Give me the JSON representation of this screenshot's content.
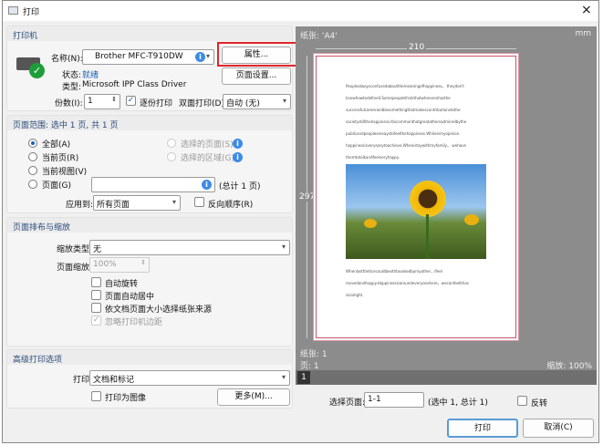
{
  "window": {
    "title": "打印",
    "close_icon": "×"
  },
  "printer": {
    "section_title": "打印机",
    "name_label": "名称(N):",
    "name_value": "Brother MFC-T910DW",
    "properties_button": "属性...",
    "page_setup_button": "页面设置...",
    "status_label": "状态:",
    "status_value": "就绪",
    "type_label": "类型:",
    "type_value": "Microsoft IPP Class Driver",
    "copies_label": "份数(I):",
    "copies_value": "1",
    "collate_label": "逐份打印",
    "collate_checked": true,
    "duplex_label": "双面打印(D)",
    "duplex_value": "自动 (无)"
  },
  "range": {
    "section_title": "页面范围: 选中 1 页, 共 1 页",
    "all": "全部(A)",
    "current_page": "当前页(R)",
    "current_view": "当前视图(V)",
    "pages": "页面(G)",
    "selected_pages": "选择的页面(S)",
    "selected_area": "选择的区域(G)",
    "pages_value": "",
    "total": "(总计 1 页)",
    "apply_label": "应用到:",
    "apply_value": "所有页面",
    "reverse_label": "反向顺序(R)"
  },
  "layout": {
    "section_title": "页面排布与缩放",
    "scale_type_label": "缩放类型:",
    "scale_type_value": "无",
    "page_scale_label": "页面缩放:",
    "page_scale_value": "100%",
    "auto_rotate": "自动旋转",
    "auto_center": "页面自动居中",
    "paper_source": "依文档页面大小选择纸张来源",
    "ignore_margins": "忽略打印机边距"
  },
  "advanced": {
    "section_title": "高级打印选项",
    "print_label": "打印",
    "print_value": "文档和标记",
    "print_as_image": "打印为图像",
    "more_button": "更多(M)..."
  },
  "preview": {
    "paper_label": "纸张: 'A4'",
    "unit": "mm",
    "width": "210",
    "height": "297",
    "paragraph1": [
      "Peoplealwaysconfusedaboutthemeaningofhappiness。 theydon't",
      "knowhowtodefineit.Somepeoplethinkthatwhenonehasthe",
      "successfulcareerandbesomethingthatmakescontributionstothe",
      "societystillthehappiness.Itiscommonthatgreatathersadmiredbythe",
      "publicandpeoplearesaystofeelthehappiness.Whileinmyopinion.",
      "happinessisveryeasytoachieve.Whenistaywithmyfamily， wehave",
      "themtotalkandfeelveryhappy."
    ],
    "paragraph2": [
      "Whenlosttheticecouldbeothtoookedbymyother，Ifeel",
      "movedandhappy.Happinessisaroundeveryonehere，wecanfeelithas",
      "issalright."
    ],
    "sheets": "纸张: 1",
    "pages": "页: 1",
    "zoom": "缩放: 100%",
    "thumb": "1"
  },
  "footer": {
    "select_pages_label": "选择页面:",
    "select_pages_value": "1-1",
    "selected_info": "(选中 1, 总计 1)",
    "flip_label": "反转",
    "print_button": "打印",
    "cancel_button": "取消(C)"
  },
  "colors": {
    "highlight": "#e0262e",
    "accent": "#1a5fb4"
  }
}
